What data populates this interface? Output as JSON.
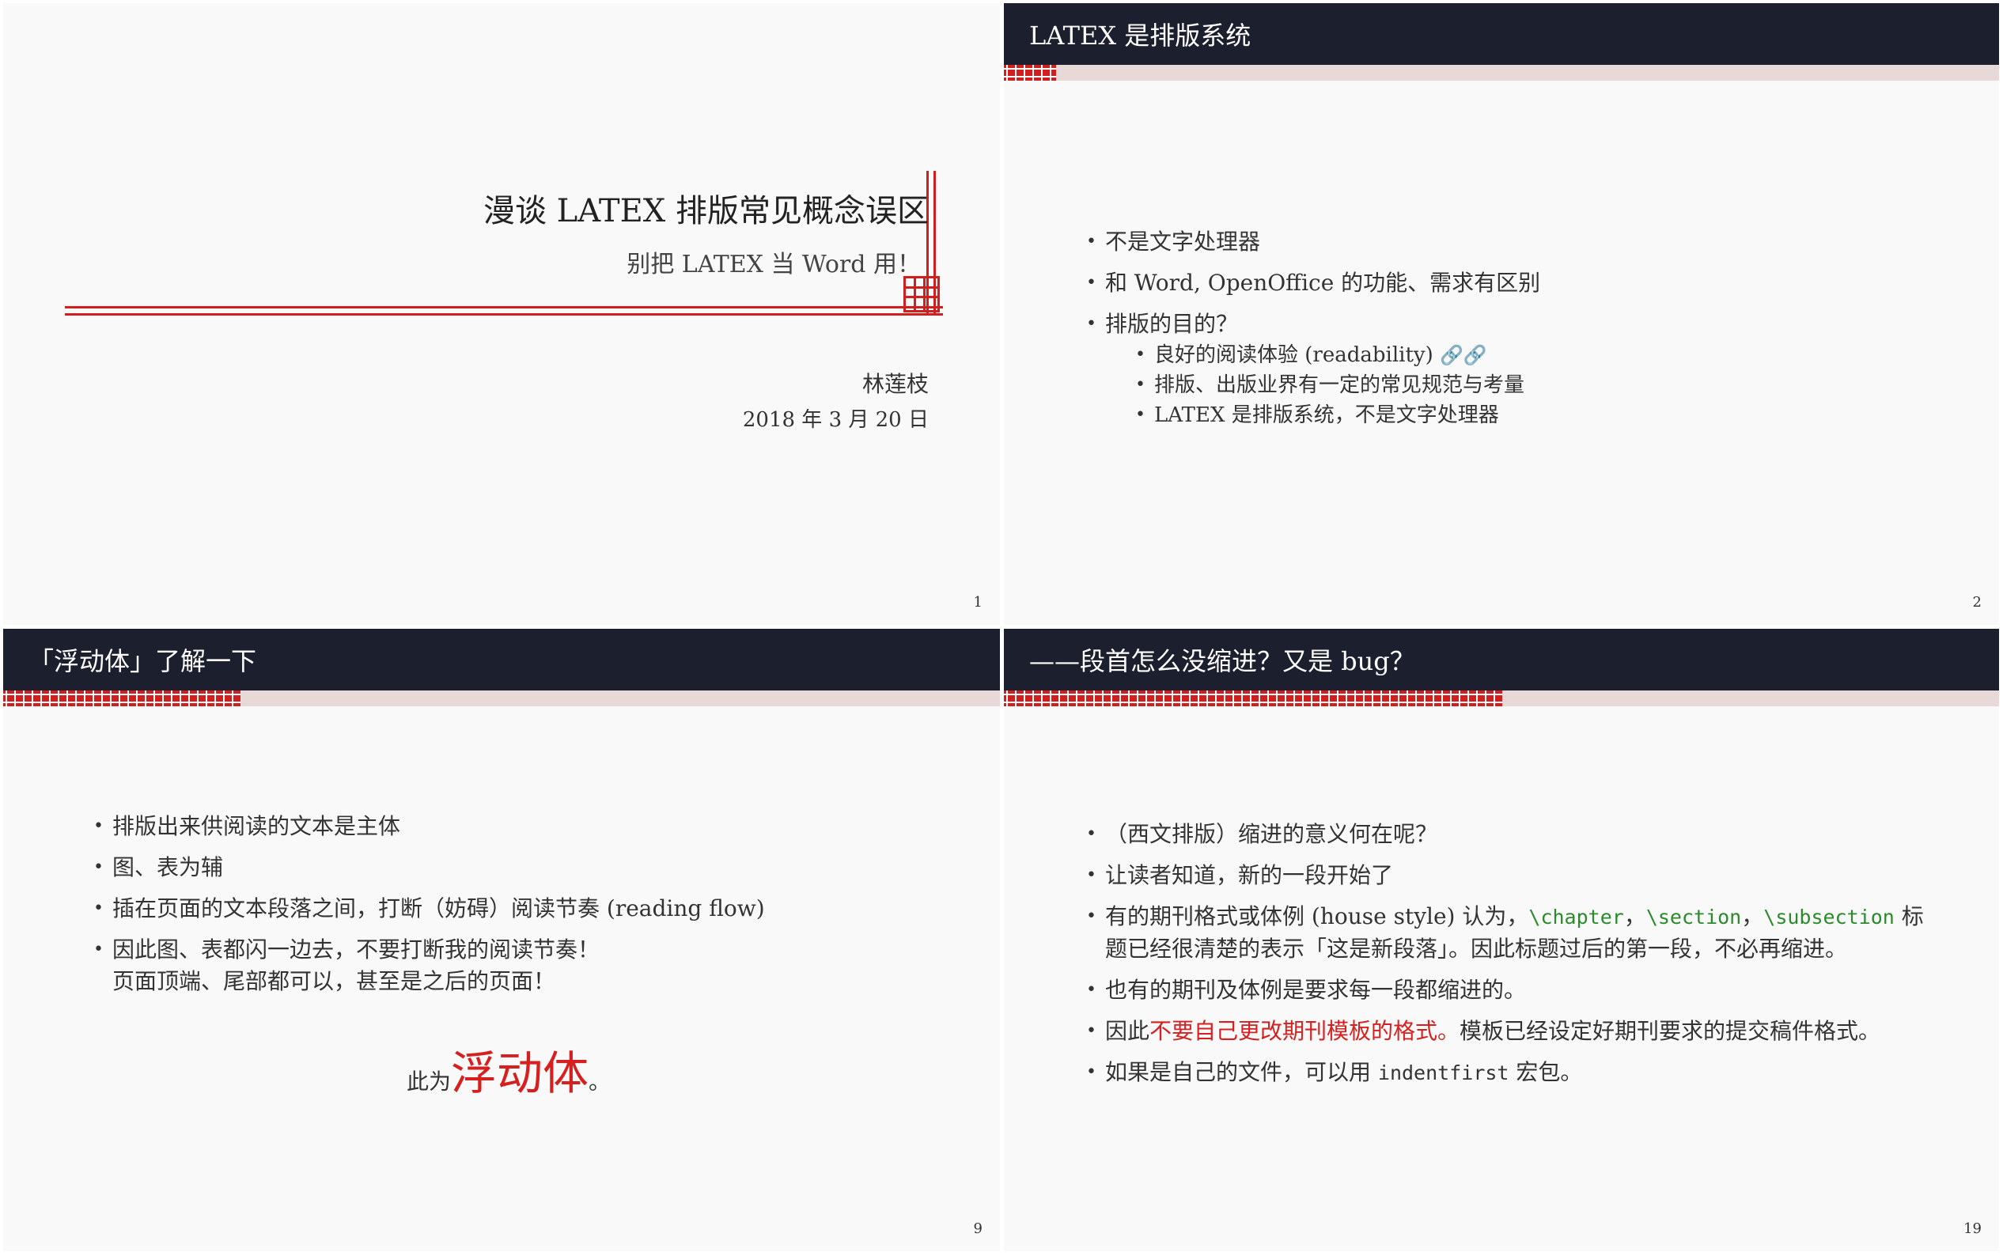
{
  "slide1": {
    "title": "漫谈 LATEX 排版常见概念误区",
    "subtitle": "别把 LATEX 当 Word 用！",
    "author": "林莲枝",
    "date": "2018 年 3 月 20 日",
    "page": "1"
  },
  "slide2": {
    "header": "LATEX 是排版系统",
    "items": [
      "不是文字处理器",
      "和 Word, OpenOffice 的功能、需求有区别",
      "排版的目的？"
    ],
    "subitems": [
      "良好的阅读体验 (readability)",
      "排版、出版业界有一定的常见规范与考量",
      "LATEX 是排版系统，不是文字处理器"
    ],
    "link_icons": "🔗🔗",
    "page": "2"
  },
  "slide9": {
    "header": "「浮动体」了解一下",
    "items": [
      "排版出来供阅读的文本是主体",
      "图、表为辅",
      "插在页面的文本段落之间，打断（妨碍）阅读节奏 (reading flow)",
      "因此图、表都闪一边去，不要打断我的阅读节奏！"
    ],
    "item4_cont": "页面顶端、尾部都可以，甚至是之后的页面！",
    "note_prefix": "此为",
    "note_big": "浮动体",
    "note_suffix": "。",
    "page": "9"
  },
  "slide19": {
    "header": "——段首怎么没缩进？又是 bug？",
    "item1": "（西文排版）缩进的意义何在呢？",
    "item2": "让读者知道，新的一段开始了",
    "item3_a": "有的期刊格式或体例 (house style) 认为，",
    "item3_cmd1": "\\chapter",
    "item3_sep1": "，",
    "item3_cmd2": "\\section",
    "item3_sep2": "，",
    "item3_cmd3": "\\subsection",
    "item3_b": " 标",
    "item3_c": "题已经很清楚的表示「这是新段落」。因此标题过后的第一段，不必再缩进。",
    "item4": "也有的期刊及体例是要求每一段都缩进的。",
    "item5_a": "因此",
    "item5_red": "不要自己更改期刊模板的格式。",
    "item5_b": "模板已经设定好期刊要求的提交稿件格式。",
    "item6_a": "如果是自己的文件，可以用 ",
    "item6_pkg": "indentfirst",
    "item6_b": " 宏包。",
    "page": "19"
  },
  "colors": {
    "header_bg": "#1c1f2e",
    "accent_red": "#d11e1e",
    "bar_bg": "#e8d9d9",
    "code_green": "#2b8a2b"
  }
}
